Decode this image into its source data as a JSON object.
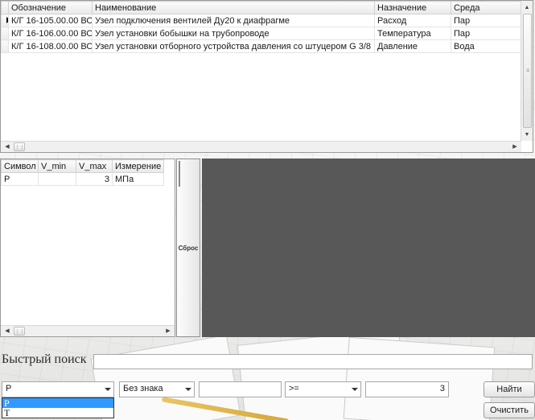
{
  "top_table": {
    "columns": [
      "Обозначение",
      "Наименование",
      "Назначение",
      "Среда"
    ],
    "rows": [
      {
        "code": "К/Г 16-105.00.00 ВО",
        "name": "Узел подключения вентилей Ду20 к диафрагме",
        "purpose": "Расход",
        "medium": "Пар"
      },
      {
        "code": "К/Г 16-106.00.00 ВО",
        "name": "Узел установки бобышки на трубопроводе",
        "purpose": "Температура",
        "medium": "Пар"
      },
      {
        "code": "К/Г 16-108.00.00 ВО",
        "name": "Узел установки отборного устройства давления со штуцером G 3/8",
        "purpose": "Давление",
        "medium": "Вода"
      }
    ]
  },
  "filter_table": {
    "columns": [
      "Символ",
      "V_min",
      "V_max",
      "Измерение"
    ],
    "rows": [
      {
        "symbol": "P",
        "vmin": "",
        "vmax": "3",
        "unit": "МПа"
      }
    ]
  },
  "reset_button": "Сброс",
  "quick_search": {
    "label": "Быстрый поиск",
    "value": ""
  },
  "filter_controls": {
    "symbol_select": "P",
    "sign_select": "Без знака",
    "text_value": "",
    "operator_select": ">=",
    "number_value": "3",
    "find_button": "Найти",
    "clear_button": "Очистить"
  },
  "symbol_dropdown": {
    "options": [
      "P",
      "T"
    ],
    "selected_index": 0
  }
}
